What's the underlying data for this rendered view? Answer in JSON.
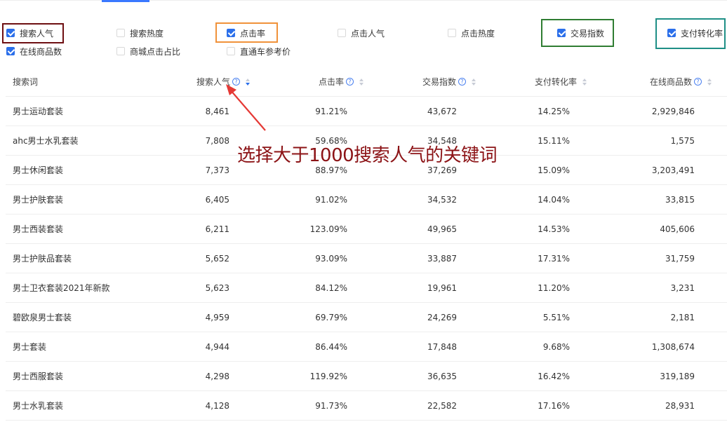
{
  "filters": [
    {
      "label": "搜索人气",
      "checked": true
    },
    {
      "label": "搜索热度",
      "checked": false
    },
    {
      "label": "点击率",
      "checked": true
    },
    {
      "label": "点击人气",
      "checked": false
    },
    {
      "label": "点击热度",
      "checked": false
    },
    {
      "label": "交易指数",
      "checked": true
    },
    {
      "label": "支付转化率",
      "checked": true
    },
    {
      "label": "在线商品数",
      "checked": true
    },
    {
      "label": "商城点击占比",
      "checked": false
    },
    {
      "label": "直通车参考价",
      "checked": false
    }
  ],
  "highlight_colors": {
    "search_popularity": "#6e0f12",
    "click_rate": "#f0923a",
    "trade_index": "#2f7d32",
    "pay_conversion": "#1e8f86"
  },
  "table": {
    "headers": [
      "搜索词",
      "搜索人气",
      "点击率",
      "交易指数",
      "支付转化率",
      "在线商品数"
    ],
    "rows": [
      [
        "男士运动套装",
        "8,461",
        "91.21%",
        "43,672",
        "14.25%",
        "2,929,846"
      ],
      [
        "ahc男士水乳套装",
        "7,808",
        "59.68%",
        "34,548",
        "15.11%",
        "1,575"
      ],
      [
        "男士休闲套装",
        "7,373",
        "88.97%",
        "37,269",
        "15.09%",
        "3,203,491"
      ],
      [
        "男士护肤套装",
        "6,405",
        "91.02%",
        "34,532",
        "14.04%",
        "33,815"
      ],
      [
        "男士西装套装",
        "6,211",
        "123.09%",
        "49,965",
        "14.53%",
        "405,606"
      ],
      [
        "男士护肤品套装",
        "5,652",
        "93.09%",
        "33,887",
        "17.31%",
        "31,759"
      ],
      [
        "男士卫衣套装2021年新款",
        "5,623",
        "84.12%",
        "19,961",
        "11.20%",
        "3,231"
      ],
      [
        "碧欧泉男士套装",
        "4,959",
        "69.79%",
        "24,269",
        "5.51%",
        "2,181"
      ],
      [
        "男士套装",
        "4,944",
        "86.44%",
        "17,848",
        "9.68%",
        "1,308,674"
      ],
      [
        "男士西服套装",
        "4,298",
        "119.92%",
        "36,635",
        "16.42%",
        "319,189"
      ],
      [
        "男士水乳套装",
        "4,128",
        "91.73%",
        "22,582",
        "17.16%",
        "28,931"
      ]
    ]
  },
  "annotation": {
    "text": "选择大于1000搜索人气的关键词",
    "color": "#8c1316",
    "arrow_color": "#e53935"
  },
  "icons": {
    "help": "?"
  }
}
